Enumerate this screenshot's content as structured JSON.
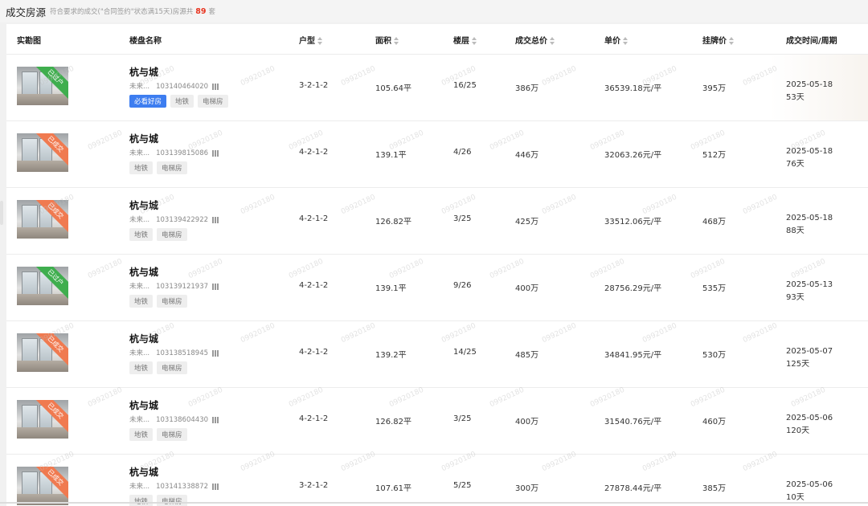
{
  "header": {
    "title": "成交房源",
    "description": "符合要求的成交(\"合同签约\"状态满15天)房源共",
    "count": "89",
    "unit": "套"
  },
  "columns": {
    "photo": "实勘图",
    "name": "楼盘名称",
    "layout": "户型",
    "area": "面积",
    "floor": "楼层",
    "total": "成交总价",
    "unit_price": "单价",
    "list_price": "挂牌价",
    "deal_time": "成交时间/周期"
  },
  "watermark": "09920180",
  "rows": [
    {
      "status": "已过户",
      "status_color": "green",
      "name": "杭与城",
      "prefix": "未来...",
      "id": "103140464020",
      "tags": [
        "必看好房",
        "地铁",
        "电梯房"
      ],
      "layout": "3-2-1-2",
      "area": "105.64平",
      "floor": "16/25",
      "total": "386万",
      "unit_price": "36539.18元/平",
      "list_price": "395万",
      "date": "2025-05-18",
      "cycle": "53天"
    },
    {
      "status": "已成交",
      "status_color": "orange",
      "name": "杭与城",
      "prefix": "未来...",
      "id": "103139815086",
      "tags": [
        "地铁",
        "电梯房"
      ],
      "layout": "4-2-1-2",
      "area": "139.1平",
      "floor": "4/26",
      "total": "446万",
      "unit_price": "32063.26元/平",
      "list_price": "512万",
      "date": "2025-05-18",
      "cycle": "76天"
    },
    {
      "status": "已成交",
      "status_color": "orange",
      "name": "杭与城",
      "prefix": "未来...",
      "id": "103139422922",
      "tags": [
        "地铁",
        "电梯房"
      ],
      "layout": "4-2-1-2",
      "area": "126.82平",
      "floor": "3/25",
      "total": "425万",
      "unit_price": "33512.06元/平",
      "list_price": "468万",
      "date": "2025-05-18",
      "cycle": "88天"
    },
    {
      "status": "已过户",
      "status_color": "green",
      "name": "杭与城",
      "prefix": "未来...",
      "id": "103139121937",
      "tags": [
        "地铁",
        "电梯房"
      ],
      "layout": "4-2-1-2",
      "area": "139.1平",
      "floor": "9/26",
      "total": "400万",
      "unit_price": "28756.29元/平",
      "list_price": "535万",
      "date": "2025-05-13",
      "cycle": "93天"
    },
    {
      "status": "已成交",
      "status_color": "orange",
      "name": "杭与城",
      "prefix": "未来...",
      "id": "103138518945",
      "tags": [
        "地铁",
        "电梯房"
      ],
      "layout": "4-2-1-2",
      "area": "139.2平",
      "floor": "14/25",
      "total": "485万",
      "unit_price": "34841.95元/平",
      "list_price": "530万",
      "date": "2025-05-07",
      "cycle": "125天"
    },
    {
      "status": "已成交",
      "status_color": "orange",
      "name": "杭与城",
      "prefix": "未来...",
      "id": "103138604430",
      "tags": [
        "地铁",
        "电梯房"
      ],
      "layout": "4-2-1-2",
      "area": "126.82平",
      "floor": "3/25",
      "total": "400万",
      "unit_price": "31540.76元/平",
      "list_price": "460万",
      "date": "2025-05-06",
      "cycle": "120天"
    },
    {
      "status": "已成交",
      "status_color": "orange",
      "name": "杭与城",
      "prefix": "未来...",
      "id": "103141338872",
      "tags": [
        "地铁",
        "电梯房"
      ],
      "layout": "3-2-1-2",
      "area": "107.61平",
      "floor": "5/25",
      "total": "300万",
      "unit_price": "27878.44元/平",
      "list_price": "385万",
      "date": "2025-05-06",
      "cycle": "10天"
    }
  ]
}
